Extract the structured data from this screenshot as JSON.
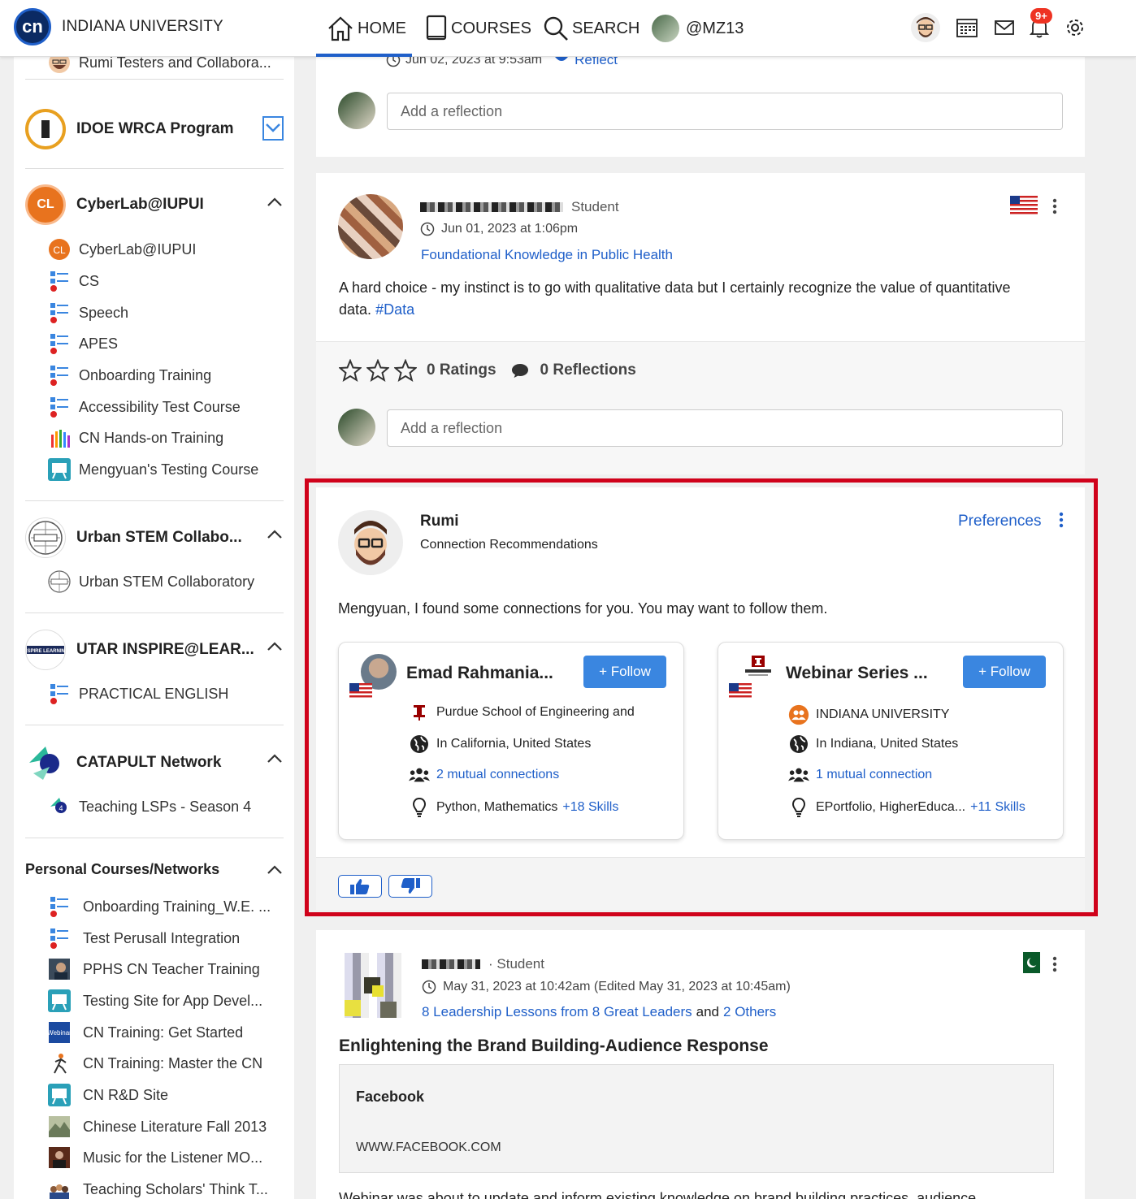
{
  "header": {
    "brand": "INDIANA UNIVERSITY",
    "logo_text": "cn",
    "nav": {
      "home": "HOME",
      "courses": "COURSES",
      "search": "SEARCH",
      "user": "@MZ13"
    },
    "notification_badge": "9+"
  },
  "sidebar": {
    "top_item": "Rumi Testers and Collabora...",
    "groups": [
      {
        "title": "IDOE WRCA Program",
        "items": []
      },
      {
        "title": "CyberLab@IUPUI",
        "items": [
          "CyberLab@IUPUI",
          "CS",
          "Speech",
          "APES",
          "Onboarding Training",
          "Accessibility Test Course",
          "CN Hands-on Training",
          "Mengyuan's Testing Course"
        ]
      },
      {
        "title": "Urban STEM Collabo...",
        "items": [
          "Urban STEM Collaboratory"
        ]
      },
      {
        "title": "UTAR INSPIRE@LEAR...",
        "items": [
          "PRACTICAL ENGLISH"
        ]
      },
      {
        "title": "CATAPULT Network",
        "items": [
          "Teaching LSPs - Season 4"
        ]
      }
    ],
    "personal_title": "Personal Courses/Networks",
    "personal_items": [
      "Onboarding Training_W.E. ...",
      "Test Perusall Integration",
      "PPHS CN Teacher Training",
      "Testing Site for App Devel...",
      "CN Training: Get Started",
      "CN Training: Master the CN",
      "CN R&D Site",
      "Chinese Literature Fall 2013",
      "Music for the Listener MO...",
      "Teaching Scholars' Think T..."
    ]
  },
  "feed": {
    "card0": {
      "timestamp": "Jun 02, 2023 at 9:53am",
      "reflect": "Reflect",
      "reflect_placeholder": "Add a reflection"
    },
    "card1": {
      "role": "Student",
      "timestamp": "Jun 01, 2023 at 1:06pm",
      "course": "Foundational Knowledge in Public Health",
      "body": "A hard choice - my instinct is to go with qualitative data but I certainly recognize the value of quantitative data.",
      "hashtag": "#Data",
      "ratings": "0 Ratings",
      "reflections": "0 Reflections",
      "reflect_placeholder": "Add a reflection"
    },
    "rumi": {
      "name": "Rumi",
      "subtitle": "Connection Recommendations",
      "preferences": "Preferences",
      "message": "Mengyuan, I found some connections for you. You may want to follow them.",
      "connections": [
        {
          "name": "Emad Rahmania...",
          "follow": "+ Follow",
          "org": "Purdue School of Engineering and",
          "location": "In California, United States",
          "mutual": "2 mutual connections",
          "skills": "Python, Mathematics",
          "more_skills": "+18 Skills"
        },
        {
          "name": "Webinar Series ...",
          "follow": "+ Follow",
          "org": "INDIANA UNIVERSITY",
          "location": "In Indiana, United States",
          "mutual": "1 mutual connection",
          "skills": "EPortfolio, HigherEduca...",
          "more_skills": "+11 Skills"
        }
      ]
    },
    "card3": {
      "role": "· Student",
      "timestamp": "May 31, 2023 at 10:42am (Edited May 31, 2023 at 10:45am)",
      "course": "8 Leadership Lessons from 8 Great Leaders",
      "and": "and",
      "others": "2 Others",
      "title": "Enlightening the Brand Building-Audience Response",
      "link_title": "Facebook",
      "link_url": "WWW.FACEBOOK.COM",
      "body_partial": "Webinar was about to update and inform existing knowledge on brand building practices, audience"
    }
  }
}
